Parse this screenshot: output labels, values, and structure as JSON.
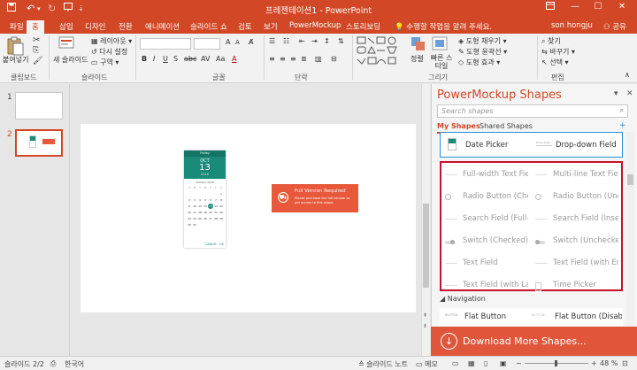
{
  "app": {
    "title": "프레젠테이션1 - PowerPoint",
    "user": "son hongju",
    "share": "공유"
  },
  "tabs": [
    "파일",
    "홈",
    "삽입",
    "디자인",
    "전환",
    "애니메이션",
    "슬라이드 쇼",
    "검토",
    "보기",
    "PowerMockup",
    "스토리보딩"
  ],
  "active_tab": "홈",
  "tell_me": "수행할 작업을 알려 주세요.",
  "ribbon": {
    "clipboard": {
      "paste": "붙여넣기",
      "label": "클립보드"
    },
    "slides": {
      "new_slide": "새 슬라이드",
      "layout": "레이아웃",
      "reset": "다시 설정",
      "section": "구역",
      "label": "슬라이드"
    },
    "font": {
      "label": "글꼴"
    },
    "paragraph": {
      "label": "단락"
    },
    "drawing": {
      "arrange": "정렬",
      "quick_styles": "빠른 스타일",
      "fill": "도형 채우기",
      "outline": "도형 윤곽선",
      "effects": "도형 효과",
      "label": "그리기"
    },
    "editing": {
      "find": "찾기",
      "replace": "바꾸기",
      "select": "선택",
      "label": "편집"
    }
  },
  "slides_panel": {
    "items": [
      {
        "num": "1"
      },
      {
        "num": "2"
      }
    ]
  },
  "slide": {
    "datepicker": {
      "header": "Friday",
      "month": "OCT",
      "day": "13",
      "year": "2016",
      "cal_title": "October 2016",
      "weekdays": [
        "S",
        "M",
        "T",
        "W",
        "T",
        "F",
        "S"
      ],
      "cancel": "CANCEL",
      "ok": "OK"
    },
    "notice": {
      "title": "Full Version Required",
      "body": "Please purchase the full version to get access to this shape."
    }
  },
  "pane": {
    "title": "PowerMockup Shapes",
    "search_placeholder": "Search shapes",
    "tab_my": "My Shapes",
    "tab_shared": "Shared Shapes",
    "featured": [
      {
        "label": "Date Picker",
        "icon": "date-picker-thumb"
      },
      {
        "label": "Drop-down Field",
        "icon": "dropdown-thumb"
      }
    ],
    "locked": [
      {
        "label": "Full-width Text Field"
      },
      {
        "label": "Multi-line Text Field"
      },
      {
        "label": "Radio Button (Che..."
      },
      {
        "label": "Radio Button (Unc..."
      },
      {
        "label": "Search Field (Full-..."
      },
      {
        "label": "Search Field (Inset)"
      },
      {
        "label": "Switch (Checked)"
      },
      {
        "label": "Switch (Unchecked)"
      },
      {
        "label": "Text Field"
      },
      {
        "label": "Text Field (with Err..."
      },
      {
        "label": "Text Field (with La..."
      },
      {
        "label": "Time Picker"
      }
    ],
    "nav_section": "Navigation",
    "nav_items": [
      {
        "label": "Flat Button",
        "thumb": "BUTTON"
      },
      {
        "label": "Flat Button (Disabl...",
        "thumb": "BUTTON"
      }
    ],
    "download": "Download More Shapes..."
  },
  "status": {
    "slide_info": "슬라이드 2/2",
    "language": "한국어",
    "notes": "슬라이드 노트",
    "comments": "메모",
    "zoom": "48 %"
  },
  "colors": {
    "brand": "#d24726",
    "teal": "#1a8a79",
    "notice": "#e8583a",
    "highlight_border": "#c8102e",
    "selected_border": "#2b8fd3"
  }
}
